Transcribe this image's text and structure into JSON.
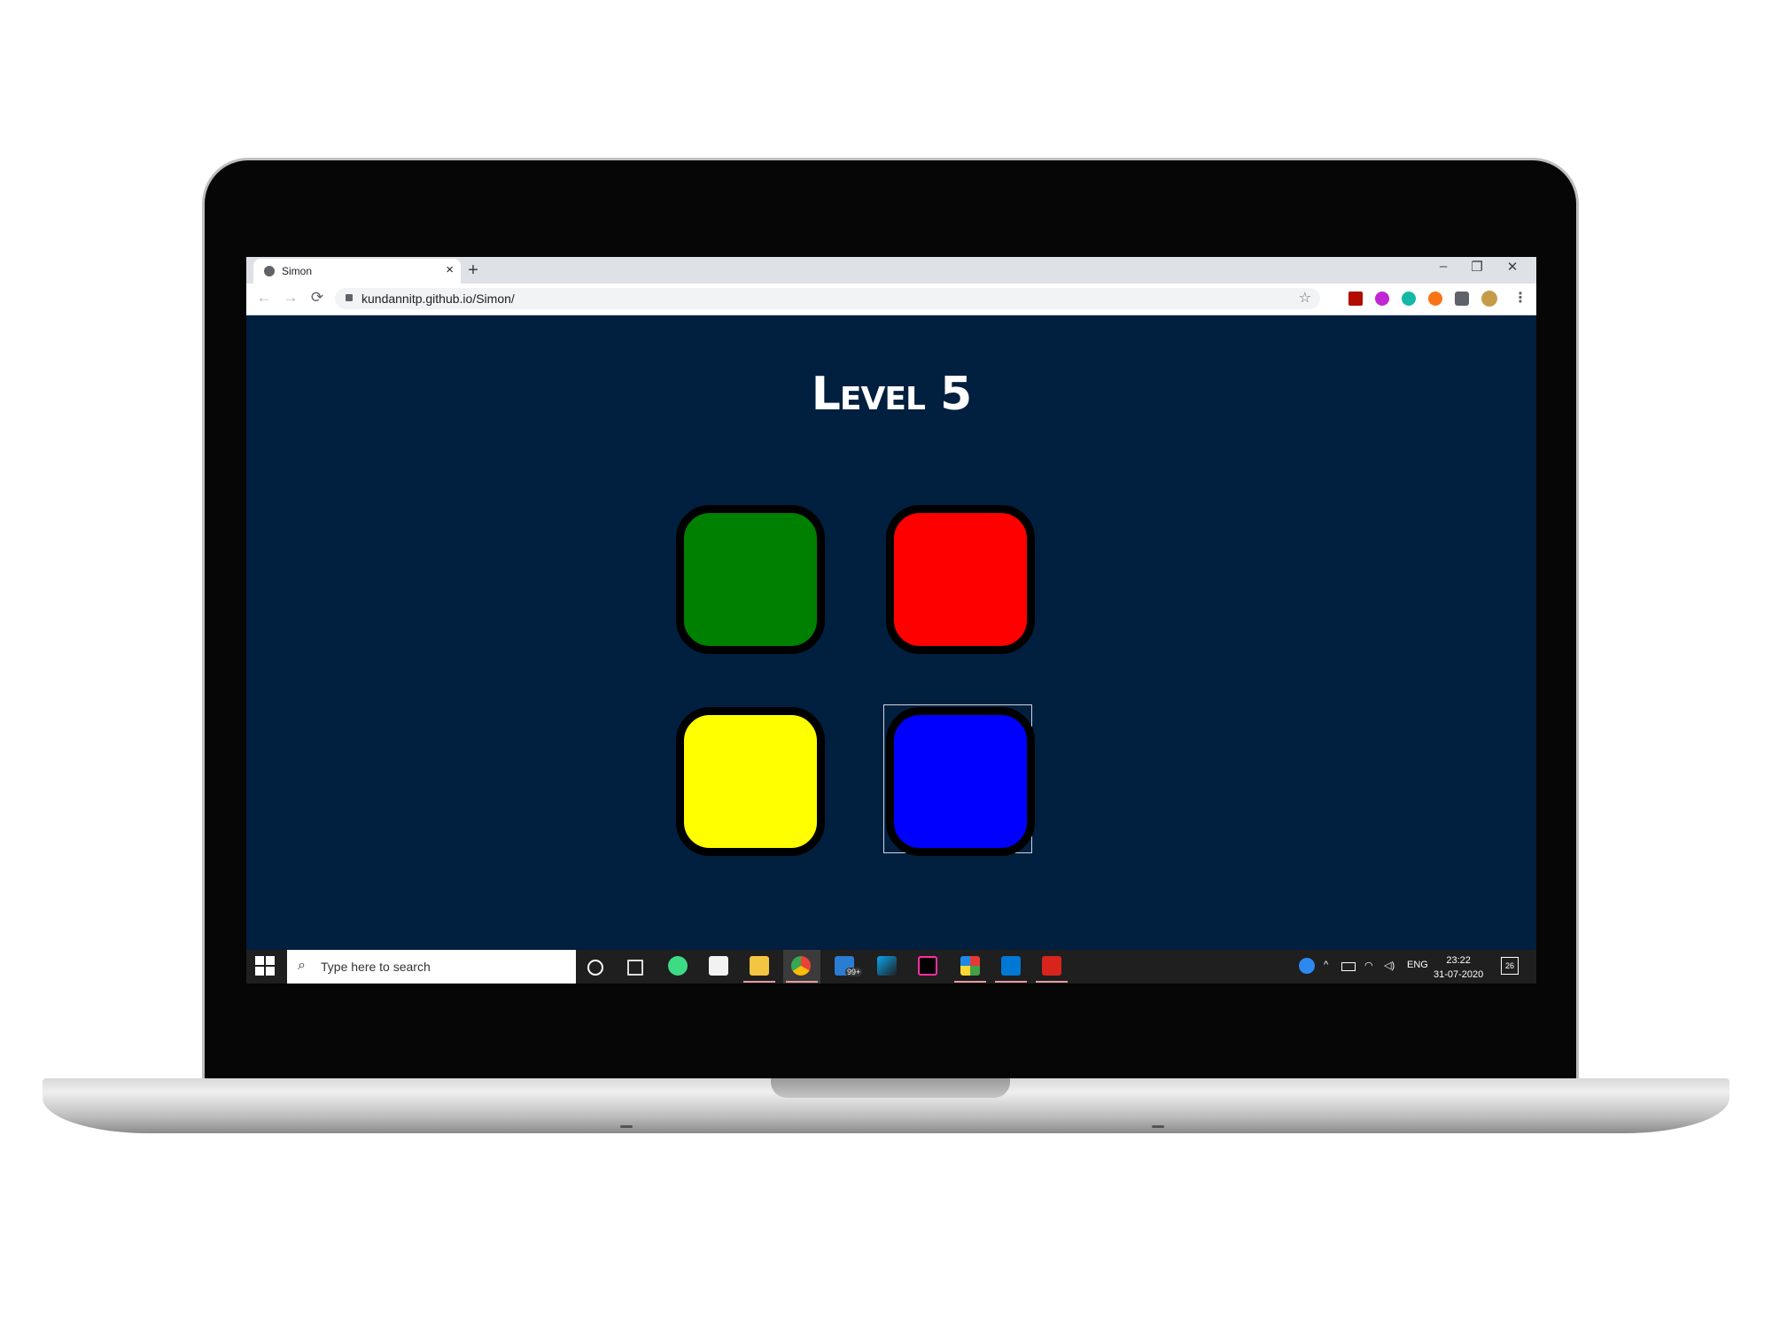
{
  "browser": {
    "tab_title": "Simon",
    "tab_close": "×",
    "new_tab": "+",
    "url": "kundannitp.github.io/Simon/",
    "minimize": "–",
    "restore": "❐",
    "close": "✕",
    "back": "←",
    "forward": "→",
    "reload": "⟳",
    "bookmark": "☆",
    "menu": "⋮"
  },
  "game": {
    "level_title": "Level 5",
    "pads": [
      {
        "id": "green",
        "color": "#008000"
      },
      {
        "id": "red",
        "color": "#FF0000"
      },
      {
        "id": "yellow",
        "color": "#FFFF00"
      },
      {
        "id": "blue",
        "color": "#0000FF"
      }
    ],
    "focused_pad": "blue"
  },
  "taskbar": {
    "search_placeholder": "Type here to search",
    "mail_badge": "99+",
    "language": "ENG",
    "time": "23:22",
    "date": "31-07-2020",
    "notification_count": "26"
  },
  "colors": {
    "page_background": "#011F3F",
    "title": "#FFFFFF"
  }
}
